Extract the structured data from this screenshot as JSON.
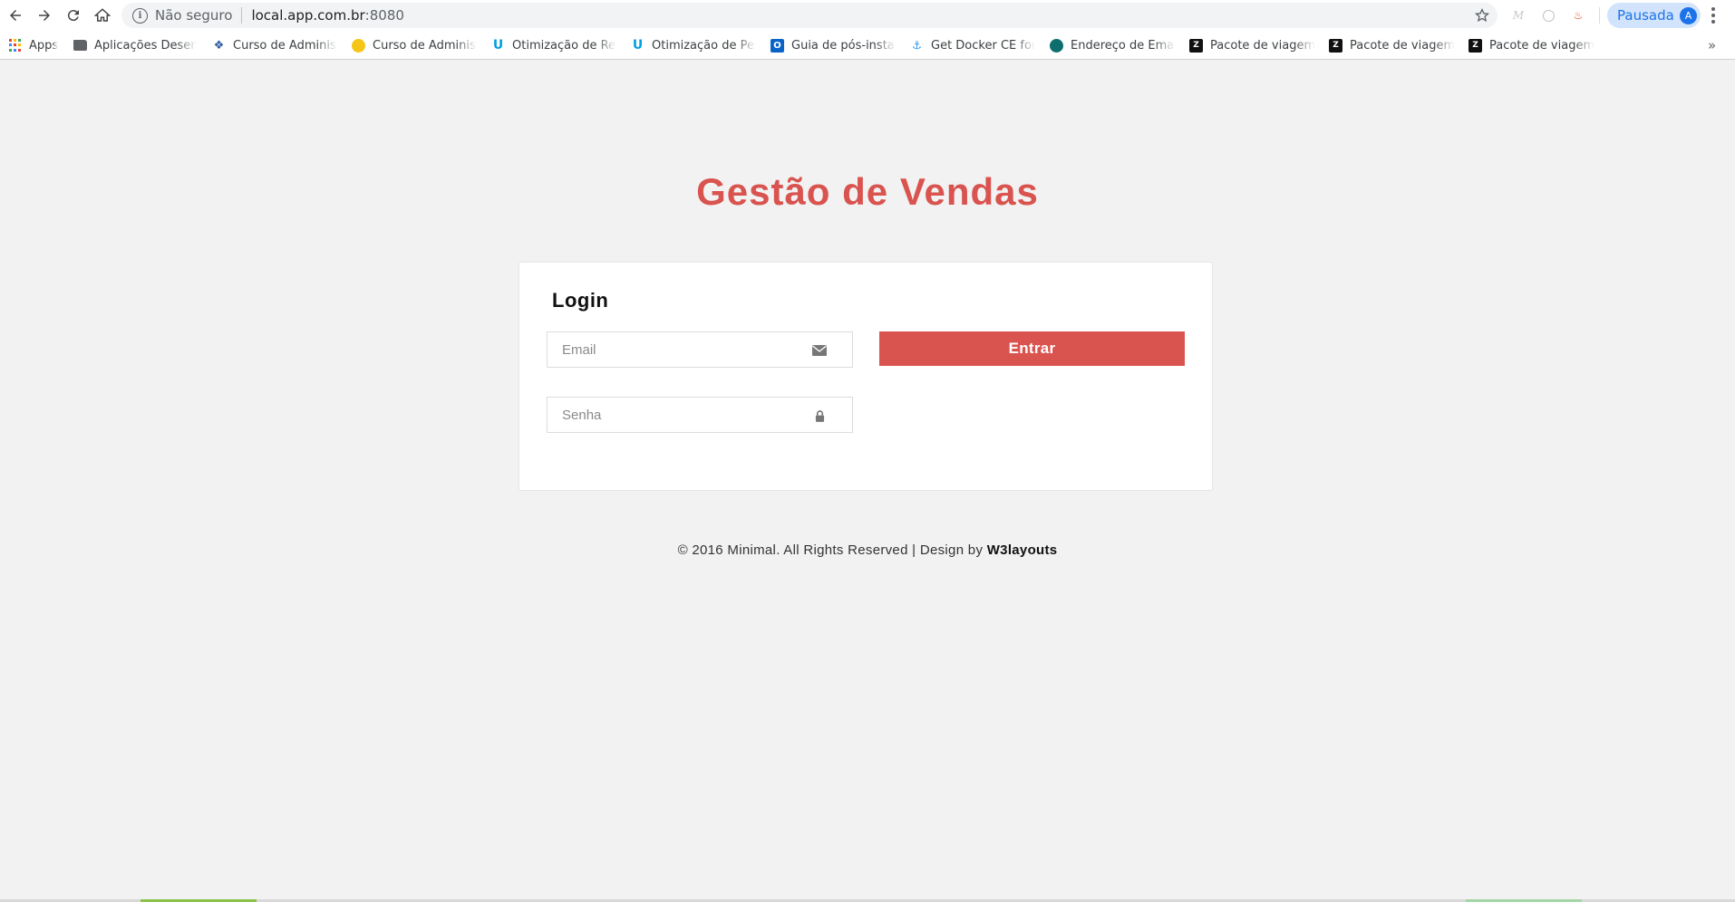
{
  "browser": {
    "security_label": "Não seguro",
    "url_host": "local.app.com.br",
    "url_port": ":8080",
    "profile_label": "Pausada",
    "profile_initial": "A"
  },
  "bookmarks": [
    {
      "label": "Apps",
      "icon": "apps-grid-icon"
    },
    {
      "label": "Aplicações Desenvolvimento",
      "icon": "folder-icon"
    },
    {
      "label": "Curso de Administração",
      "icon": "bird-icon"
    },
    {
      "label": "Curso de Administração",
      "icon": "sun-icon"
    },
    {
      "label": "Otimização de Recursos",
      "icon": "udemy-icon"
    },
    {
      "label": "Otimização de Performance",
      "icon": "udemy-icon"
    },
    {
      "label": "Guia de pós-instalação",
      "icon": "outlook-icon"
    },
    {
      "label": "Get Docker CE for",
      "icon": "docker-icon"
    },
    {
      "label": "Endereço de Email",
      "icon": "globe-icon"
    },
    {
      "label": "Pacote de viagem",
      "icon": "zend-icon"
    },
    {
      "label": "Pacote de viagem",
      "icon": "zend-icon"
    },
    {
      "label": "Pacote de viagem",
      "icon": "zend-icon"
    }
  ],
  "page": {
    "title": "Gestão de Vendas",
    "login_heading": "Login",
    "email_placeholder": "Email",
    "password_placeholder": "Senha",
    "submit_label": "Entrar",
    "footer_text": "© 2016 Minimal. All Rights Reserved | Design by ",
    "footer_link": "W3layouts"
  },
  "colors": {
    "accent": "#d9534f",
    "background": "#f2f2f2",
    "card": "#ffffff"
  }
}
